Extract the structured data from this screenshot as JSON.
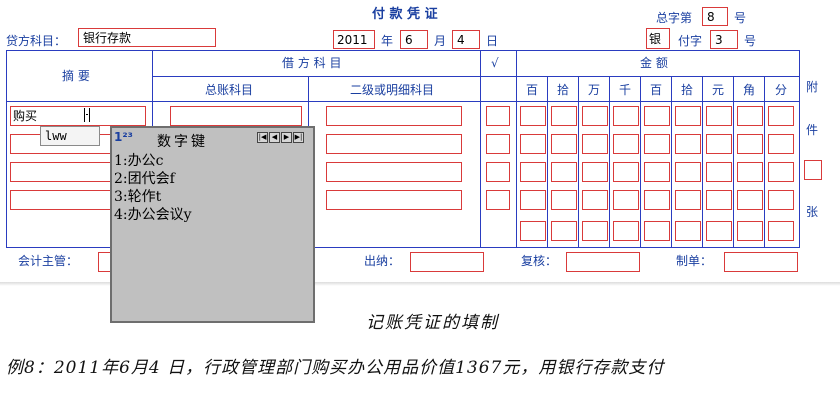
{
  "header": {
    "title": "付 款 凭 证",
    "zongzi_label": "总字第",
    "zongzi_value": "8",
    "hao_label": "号",
    "credit_account_label": "贷方科目：",
    "credit_account_value": "银行存款",
    "year": "2011",
    "year_label": "年",
    "month": "6",
    "month_label": "月",
    "day": "4",
    "day_label": "日",
    "fuzi_prefix": "银",
    "fuzi_label": "付字",
    "fuzi_value": "3",
    "fuzi_hao_label": "号"
  },
  "table": {
    "summary_header": "摘 要",
    "debit_header": "借 方 科 目",
    "check_header": "√",
    "amount_header": "金 额",
    "general_account_header": "总账科目",
    "detail_account_header": "二级或明细科目",
    "digit_headers": [
      "百",
      "拾",
      "万",
      "千",
      "百",
      "拾",
      "元",
      "角",
      "分"
    ],
    "attachment_label": [
      "附",
      "件",
      "张"
    ],
    "rows": [
      {
        "summary": "购买",
        "general": "",
        "detail": ""
      },
      {
        "summary": "",
        "general": "",
        "detail": ""
      },
      {
        "summary": "",
        "general": "",
        "detail": ""
      },
      {
        "summary": "",
        "general": "",
        "detail": ""
      }
    ]
  },
  "footer": {
    "accountant_label": "会计主管：",
    "cashier_label": "出纳：",
    "review_label": "复核：",
    "maker_label": "制单："
  },
  "ime": {
    "composition": "lww",
    "numpad_icon": "1²³",
    "numpad_title": "数字键",
    "nav_buttons": [
      "first-icon",
      "prev-icon",
      "next-icon",
      "last-icon"
    ],
    "candidates": [
      "1:办公c",
      "2:团代会f",
      "3:轮作t",
      "4:办公会议y"
    ]
  },
  "caption": {
    "title": "记账凭证的填制",
    "example": "例8：2011年6月4 日，行政管理部门购买办公用品价值1367元，用银行存款支付"
  },
  "colors": {
    "label_blue": "#1a3fa0",
    "grid_blue": "#2a3cc0",
    "box_red": "#d93a3a",
    "numpad_gray": "#c0c0c0"
  }
}
